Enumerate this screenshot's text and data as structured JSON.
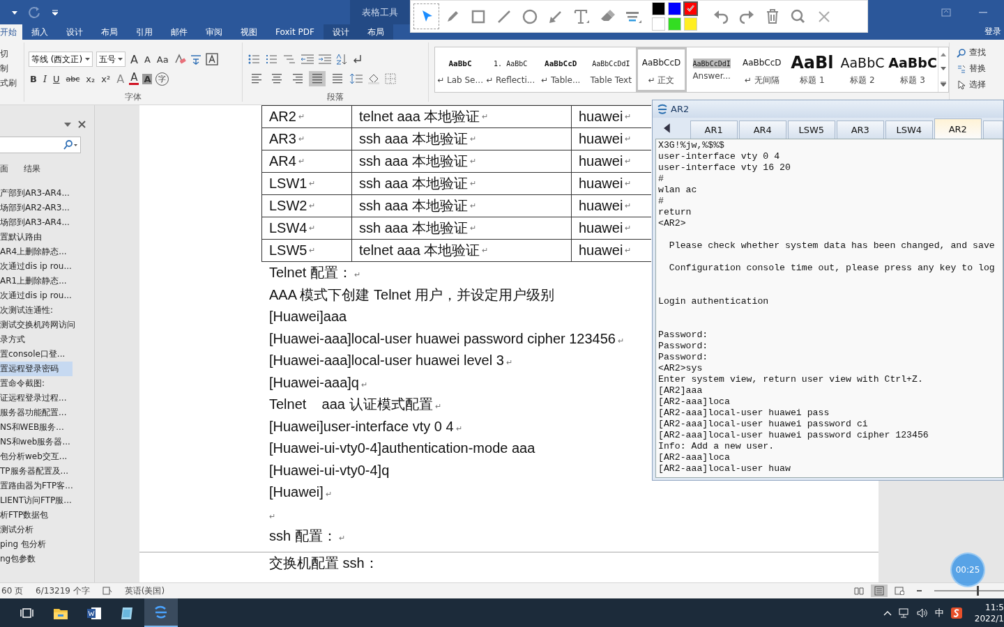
{
  "title_bar": {
    "context_label": "表格工具",
    "sign_in": "登录"
  },
  "ribbon_tabs": [
    {
      "label": "开始",
      "selected": true,
      "context": false
    },
    {
      "label": "插入",
      "selected": false,
      "context": false
    },
    {
      "label": "设计",
      "selected": false,
      "context": false
    },
    {
      "label": "布局",
      "selected": false,
      "context": false
    },
    {
      "label": "引用",
      "selected": false,
      "context": false
    },
    {
      "label": "邮件",
      "selected": false,
      "context": false
    },
    {
      "label": "审阅",
      "selected": false,
      "context": false
    },
    {
      "label": "视图",
      "selected": false,
      "context": false
    },
    {
      "label": "Foxit PDF",
      "selected": false,
      "context": false
    },
    {
      "label": "设计",
      "selected": false,
      "context": true
    },
    {
      "label": "布局",
      "selected": false,
      "context": true
    }
  ],
  "clipboard": [
    "切",
    "制",
    "式刷"
  ],
  "font_group": {
    "font": "等线 (西文正)",
    "size": "五号",
    "label": "字体",
    "row1": [
      {
        "label": "A",
        "kind": "grow"
      },
      {
        "label": "A",
        "kind": "shrink"
      },
      {
        "label": "Aa",
        "kind": "case"
      }
    ],
    "row2": [
      {
        "label": "B",
        "kind": "bold"
      },
      {
        "label": "I",
        "kind": "italic"
      },
      {
        "label": "U",
        "kind": "underline"
      },
      {
        "label": "abc",
        "kind": "strike"
      },
      {
        "label": "x₂",
        "kind": "sub"
      },
      {
        "label": "x²",
        "kind": "sup"
      },
      {
        "label": "A",
        "kind": "effects"
      },
      {
        "label": "A",
        "kind": "color"
      },
      {
        "label": "A",
        "kind": "shade"
      },
      {
        "label": "字",
        "kind": "enclose"
      }
    ]
  },
  "paragraph_group": {
    "label": "段落",
    "align": [
      {
        "kind": "left",
        "selected": false
      },
      {
        "kind": "center",
        "selected": false
      },
      {
        "kind": "right",
        "selected": false
      },
      {
        "kind": "justify",
        "selected": true
      },
      {
        "kind": "distribute",
        "selected": false
      }
    ]
  },
  "styles": [
    {
      "preview": "AaBbC",
      "label": "↵ Lab Se...",
      "kind": "mono-bold",
      "selected": false
    },
    {
      "preview": "1.  AaBbC",
      "label": "↵ Reflecti...",
      "kind": "mono",
      "selected": false
    },
    {
      "preview": "AaBbCcD",
      "label": "↵ Table...",
      "kind": "mono-bold",
      "selected": false
    },
    {
      "preview": "AaBbCcDdI",
      "label": "Table Text",
      "kind": "mono",
      "selected": false
    },
    {
      "preview": "AaBbCcD",
      "label": "↵ 正文",
      "kind": "normal",
      "selected": true
    },
    {
      "preview": "AaBbCcDdI",
      "label": "Answer...",
      "kind": "shaded",
      "selected": false
    },
    {
      "preview": "AaBbCcD",
      "label": "↵ 无间隔",
      "kind": "normal",
      "selected": false
    },
    {
      "preview": "AaBl",
      "label": "标题 1",
      "kind": "h1",
      "selected": false
    },
    {
      "preview": "AaBbC",
      "label": "标题 2",
      "kind": "h2",
      "selected": false
    },
    {
      "preview": "AaBbC",
      "label": "标题 3",
      "kind": "h3",
      "selected": false
    }
  ],
  "editing": [
    {
      "label": "查找",
      "kind": "find"
    },
    {
      "label": "替换",
      "kind": "replace"
    },
    {
      "label": "选择",
      "kind": "select"
    }
  ],
  "nav_pane": {
    "tabs": [
      "面",
      "结果"
    ],
    "items": [
      {
        "text": "产部到AR3-AR4...",
        "selected": false
      },
      {
        "text": "场部到AR2-AR3...",
        "selected": false
      },
      {
        "text": "场部到AR3-AR4...",
        "selected": false
      },
      {
        "text": "置默认路由",
        "selected": false
      },
      {
        "text": "AR4上删除静态...",
        "selected": false
      },
      {
        "text": "次通过dis ip rou...",
        "selected": false
      },
      {
        "text": "AR1上删除静态...",
        "selected": false
      },
      {
        "text": "次通过dis ip rou...",
        "selected": false
      },
      {
        "text": "次测试连通性:",
        "selected": false
      },
      {
        "text": "测试交换机跨网访问",
        "selected": false
      },
      {
        "text": "录方式",
        "selected": false
      },
      {
        "text": "置console口登...",
        "selected": false
      },
      {
        "text": "置远程登录密码",
        "selected": true
      },
      {
        "text": "置命令截图:",
        "selected": false
      },
      {
        "text": "证远程登录过程...",
        "selected": false
      },
      {
        "text": "服务器功能配置...",
        "selected": false
      },
      {
        "text": "NS和WEB服务...",
        "selected": false
      },
      {
        "text": "NS和web服务器...",
        "selected": false
      },
      {
        "text": "包分析web交互...",
        "selected": false
      },
      {
        "text": "TP服务器配置及...",
        "selected": false
      },
      {
        "text": "置路由器为FTP客...",
        "selected": false
      },
      {
        "text": "LIENT访问FTP服...",
        "selected": false
      },
      {
        "text": "析FTP数据包",
        "selected": false
      },
      {
        "text": "测试分析",
        "selected": false
      },
      {
        "text": "ping 包分析",
        "selected": false
      },
      {
        "text": "ng包参数",
        "selected": false
      }
    ]
  },
  "document": {
    "table_rows": [
      [
        {
          "text": "AR2",
          "end_mark": "↵"
        },
        {
          "text": "telnet aaa 本地验证",
          "end_mark": "↵"
        },
        {
          "text": "huawei",
          "end_mark": "↵"
        }
      ],
      [
        {
          "text": "AR3",
          "end_mark": "↵"
        },
        {
          "text": "ssh aaa 本地验证",
          "end_mark": "↵"
        },
        {
          "text": "huawei",
          "end_mark": "↵"
        }
      ],
      [
        {
          "text": "AR4",
          "end_mark": "↵"
        },
        {
          "text": "ssh aaa 本地验证",
          "end_mark": "↵"
        },
        {
          "text": "huawei",
          "end_mark": "↵"
        }
      ],
      [
        {
          "text": "LSW1",
          "end_mark": "↵"
        },
        {
          "text": "ssh aaa 本地验证",
          "end_mark": "↵"
        },
        {
          "text": "huawei",
          "end_mark": "↵"
        }
      ],
      [
        {
          "text": "LSW2",
          "end_mark": "↵"
        },
        {
          "text": "ssh aaa 本地验证",
          "end_mark": "↵"
        },
        {
          "text": "huawei",
          "end_mark": "↵"
        }
      ],
      [
        {
          "text": "LSW4",
          "end_mark": "↵"
        },
        {
          "text": "ssh aaa 本地验证",
          "end_mark": "↵"
        },
        {
          "text": "huawei",
          "end_mark": "↵"
        }
      ],
      [
        {
          "text": "LSW5",
          "end_mark": "↵"
        },
        {
          "text": "telnet aaa 本地验证",
          "end_mark": "↵"
        },
        {
          "text": "huawei",
          "end_mark": "↵"
        }
      ]
    ],
    "paragraphs": [
      {
        "text": "Telnet 配置：",
        "end_mark": "↵"
      },
      {
        "text": "AAA 模式下创建 Telnet 用户，并设定用户级别"
      },
      {
        "text": "[Huawei]aaa"
      },
      {
        "text": "[Huawei-aaa]local-user huawei password cipher 123456",
        "end_mark": "↵"
      },
      {
        "text": "[Huawei-aaa]local-user huawei level 3",
        "end_mark": "↵"
      },
      {
        "text": "[Huawei-aaa]q",
        "end_mark": "↵"
      },
      {
        "text": "Telnet    aaa 认证模式配置",
        "end_mark": "↵"
      },
      {
        "text": "[Huawei]user-interface vty 0 4",
        "end_mark": "↵"
      },
      {
        "text": "[Huawei-ui-vty0-4]authentication-mode aaa"
      },
      {
        "text": "[Huawei-ui-vty0-4]q"
      },
      {
        "text": "[Huawei]",
        "end_mark": "↵"
      },
      {
        "end_mark": "↵"
      },
      {
        "text": "ssh 配置：",
        "end_mark": "↵"
      }
    ],
    "next_page_line": "交换机配置 ssh："
  },
  "status_bar": {
    "pages": "60 页",
    "words": "6/13219 个字",
    "language": "英语(美国)",
    "zoom": {
      "level": 0.55
    }
  },
  "annotation_toolbar": {
    "tools": [
      {
        "kind": "select",
        "selected": true
      },
      {
        "kind": "pen",
        "selected": false
      },
      {
        "kind": "rect",
        "selected": false
      },
      {
        "kind": "line",
        "selected": false
      },
      {
        "kind": "circle",
        "selected": false
      },
      {
        "kind": "arrow",
        "selected": false
      },
      {
        "kind": "text",
        "selected": false
      },
      {
        "kind": "eraser",
        "selected": false
      },
      {
        "kind": "width",
        "selected": false
      }
    ],
    "colors": [
      {
        "color": "#000000",
        "selected": false
      },
      {
        "color": "#0000ff",
        "selected": false
      },
      {
        "color": "#ff0000",
        "selected": true
      },
      {
        "color": "#ffffff",
        "selected": false
      },
      {
        "color": "#33dd22",
        "selected": false
      },
      {
        "color": "#ffee22",
        "selected": false
      }
    ],
    "actions": [
      {
        "kind": "undo"
      },
      {
        "kind": "redo"
      },
      {
        "kind": "delete"
      },
      {
        "kind": "zoom"
      },
      {
        "kind": "close"
      }
    ]
  },
  "terminal": {
    "title": "AR2",
    "tabs": [
      {
        "label": "AR1",
        "selected": false
      },
      {
        "label": "AR4",
        "selected": false
      },
      {
        "label": "LSW5",
        "selected": false
      },
      {
        "label": "AR3",
        "selected": false
      },
      {
        "label": "LSW4",
        "selected": false
      },
      {
        "label": "AR2",
        "selected": true
      }
    ],
    "lines": [
      {
        "text": "X3G!%jw,%$%$",
        "kind": "line"
      },
      {
        "text": "user-interface vty 0 4",
        "kind": "line"
      },
      {
        "text": "user-interface vty 16 20",
        "kind": "line"
      },
      {
        "text": "#",
        "kind": "line"
      },
      {
        "text": "wlan ac",
        "kind": "line"
      },
      {
        "text": "#",
        "kind": "line"
      },
      {
        "text": "return",
        "kind": "line"
      },
      {
        "text": "<AR2>",
        "kind": "line"
      },
      {
        "text": "  Please check whether system data has been changed, and save",
        "kind": "para"
      },
      {
        "text": "  Configuration console time out, please press any key to log",
        "kind": "para"
      },
      {
        "text": "Login authentication",
        "kind": "section"
      },
      {
        "text": "Password:",
        "kind": "section"
      },
      {
        "text": "Password:",
        "kind": "line"
      },
      {
        "text": "Password:",
        "kind": "line"
      },
      {
        "text": "<AR2>sys",
        "kind": "line"
      },
      {
        "text": "Enter system view, return user view with Ctrl+Z.",
        "kind": "line"
      },
      {
        "text": "[AR2]aaa",
        "kind": "line"
      },
      {
        "text": "[AR2-aaa]loca",
        "kind": "line"
      },
      {
        "text": "[AR2-aaa]local-user huawei pass",
        "kind": "line"
      },
      {
        "text": "[AR2-aaa]local-user huawei password ci",
        "kind": "line"
      },
      {
        "text": "[AR2-aaa]local-user huawei password cipher 123456",
        "kind": "line"
      },
      {
        "text": "Info: Add a new user.",
        "kind": "line"
      },
      {
        "text": "[AR2-aaa]loca",
        "kind": "line"
      },
      {
        "text": "[AR2-aaa]local-user huaw",
        "kind": "line"
      }
    ]
  },
  "timer": "00:25",
  "taskbar": {
    "apps": [
      {
        "kind": "taskview",
        "active": false
      },
      {
        "kind": "folder",
        "active": false
      },
      {
        "kind": "word",
        "active": false
      },
      {
        "kind": "notebook",
        "active": false
      },
      {
        "kind": "ensp",
        "active": true
      }
    ],
    "ime": "中",
    "time": "11:5",
    "date": "2022/1"
  }
}
